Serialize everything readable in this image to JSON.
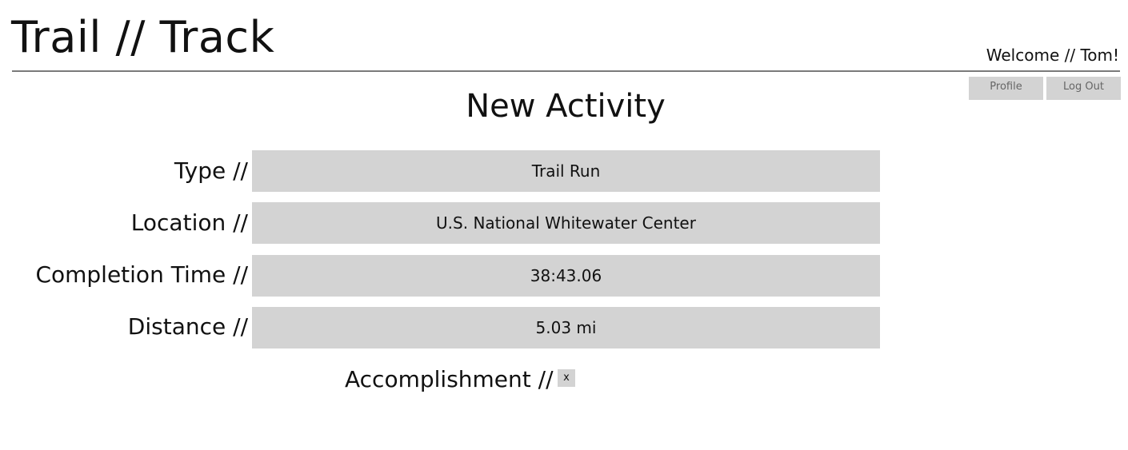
{
  "header": {
    "app_title": "Trail // Track",
    "welcome": "Welcome // Tom!",
    "profile_label": "Profile",
    "logout_label": "Log Out"
  },
  "page": {
    "title": "New Activity"
  },
  "form": {
    "type": {
      "label": "Type //",
      "value": "Trail Run"
    },
    "location": {
      "label": "Location //",
      "value": "U.S. National Whitewater Center"
    },
    "completion_time": {
      "label": "Completion Time //",
      "value": "38:43.06"
    },
    "distance": {
      "label": "Distance //",
      "value": "5.03 mi"
    },
    "accomplishment": {
      "label": "Accomplishment //",
      "checkbox_mark": "x"
    }
  },
  "colors": {
    "field_background": "#d3d3d3",
    "header_rule": "#7a7a7a"
  }
}
